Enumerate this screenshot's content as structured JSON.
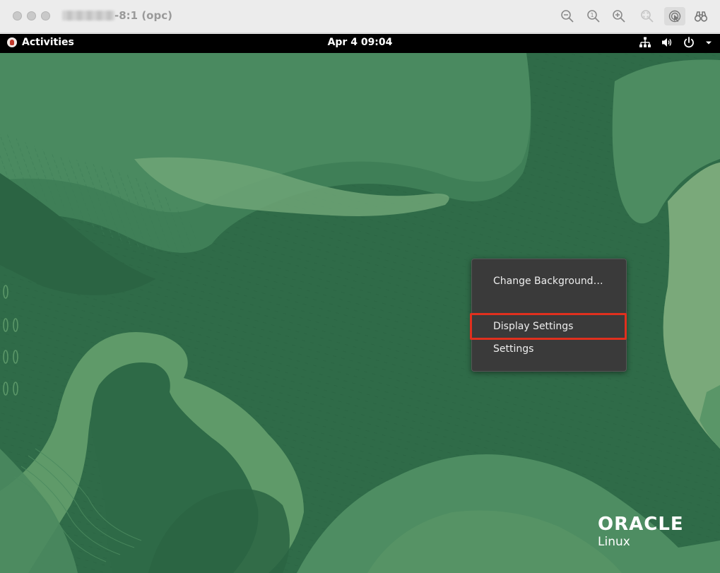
{
  "viewer": {
    "title": "-8:1 (opc)",
    "toolbar": [
      "zoom-out-icon",
      "zoom-reset-icon",
      "zoom-in-icon",
      "zoom-fit-icon",
      "remote-pointer-icon",
      "binoculars-icon"
    ]
  },
  "panel": {
    "activities_label": "Activities",
    "clock": "Apr 4  09:04",
    "tray": [
      "network-icon",
      "volume-icon",
      "power-icon",
      "chevron-down-icon"
    ]
  },
  "context_menu": {
    "items": [
      {
        "label": "Change Background…"
      },
      {
        "label": "Display Settings",
        "highlighted": true
      },
      {
        "label": "Settings"
      }
    ],
    "highlight_color": "#e0301e"
  },
  "branding": {
    "name": "ORACLE",
    "product": "Linux"
  },
  "colors": {
    "desktop_green": "#2f6b48",
    "light_green": "#4f9066",
    "menu_bg": "#3a3a3a"
  }
}
